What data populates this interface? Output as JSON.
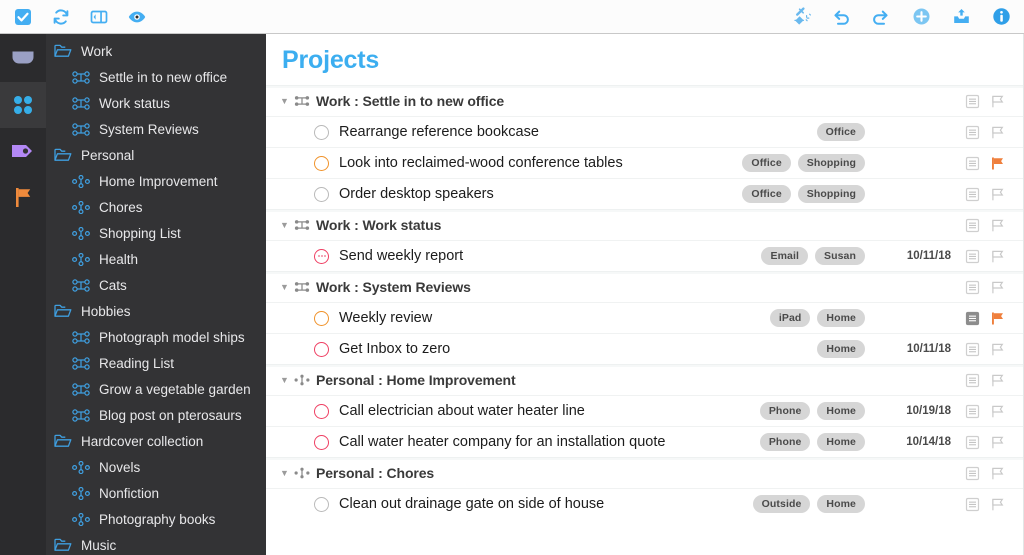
{
  "toolbar": {
    "left": [
      {
        "name": "checkmark-icon",
        "label": "Mark Complete"
      },
      {
        "name": "sync-icon",
        "label": "Sync"
      },
      {
        "name": "sidebar-toggle-icon",
        "label": "Toggle Sidebar"
      },
      {
        "name": "view-icon",
        "label": "View"
      }
    ],
    "right": [
      {
        "name": "cleanup-icon",
        "label": "Clean Up"
      },
      {
        "name": "undo-icon",
        "label": "Undo"
      },
      {
        "name": "redo-icon",
        "label": "Redo"
      },
      {
        "name": "add-icon",
        "label": "Add"
      },
      {
        "name": "inbox-icon",
        "label": "Inbox"
      },
      {
        "name": "info-icon",
        "label": "Inspector"
      }
    ]
  },
  "rail": [
    {
      "name": "rail-inbox",
      "icon": "inbox-tray-icon",
      "color": "#9aa0c4",
      "selected": false
    },
    {
      "name": "rail-projects",
      "icon": "projects-dots-icon",
      "color": "#36aee8",
      "selected": true
    },
    {
      "name": "rail-tags",
      "icon": "tag-icon",
      "color": "#b388f5",
      "selected": false
    },
    {
      "name": "rail-forecast",
      "icon": "flag-icon",
      "color": "#ef8a3c",
      "selected": false
    }
  ],
  "sidebar": {
    "items": [
      {
        "label": "Work",
        "type": "folder",
        "level": 0
      },
      {
        "label": "Settle in to new office",
        "type": "sequential",
        "level": 1
      },
      {
        "label": "Work status",
        "type": "sequential",
        "level": 1
      },
      {
        "label": "System Reviews",
        "type": "sequential",
        "level": 1
      },
      {
        "label": "Personal",
        "type": "folder",
        "level": 0
      },
      {
        "label": "Home Improvement",
        "type": "parallel",
        "level": 1
      },
      {
        "label": "Chores",
        "type": "parallel",
        "level": 1
      },
      {
        "label": "Shopping List",
        "type": "parallel",
        "level": 1
      },
      {
        "label": "Health",
        "type": "parallel",
        "level": 1
      },
      {
        "label": "Cats",
        "type": "sequential",
        "level": 1
      },
      {
        "label": "Hobbies",
        "type": "folder",
        "level": 0
      },
      {
        "label": "Photograph model ships",
        "type": "sequential",
        "level": 1
      },
      {
        "label": "Reading List",
        "type": "sequential",
        "level": 1
      },
      {
        "label": "Grow a vegetable garden",
        "type": "sequential",
        "level": 1
      },
      {
        "label": "Blog post on pterosaurs",
        "type": "sequential",
        "level": 1
      },
      {
        "label": "Hardcover collection",
        "type": "folder",
        "level": 0
      },
      {
        "label": "Novels",
        "type": "parallel",
        "level": 1
      },
      {
        "label": "Nonfiction",
        "type": "parallel",
        "level": 1
      },
      {
        "label": "Photography books",
        "type": "parallel",
        "level": 1
      },
      {
        "label": "Music",
        "type": "folder",
        "level": 0
      }
    ]
  },
  "main": {
    "title": "Projects",
    "groups": [
      {
        "title": "Work : Settle in to new office",
        "project_type": "sequential",
        "expanded": true,
        "has_note": true,
        "flagged": false,
        "tasks": [
          {
            "name": "Rearrange reference bookcase",
            "status": "available",
            "tags": [
              "Office"
            ],
            "due": "",
            "has_note": true,
            "note_active": false,
            "flagged": false
          },
          {
            "name": "Look into reclaimed-wood conference tables",
            "status": "next",
            "tags": [
              "Office",
              "Shopping"
            ],
            "due": "",
            "has_note": true,
            "note_active": false,
            "flagged": true
          },
          {
            "name": "Order desktop speakers",
            "status": "available",
            "tags": [
              "Office",
              "Shopping"
            ],
            "due": "",
            "has_note": true,
            "note_active": false,
            "flagged": false
          }
        ]
      },
      {
        "title": "Work : Work status",
        "project_type": "sequential",
        "expanded": true,
        "has_note": true,
        "flagged": false,
        "tasks": [
          {
            "name": "Send weekly report",
            "status": "due-repeating",
            "tags": [
              "Email",
              "Susan"
            ],
            "due": "10/11/18",
            "has_note": true,
            "note_active": false,
            "flagged": false
          }
        ]
      },
      {
        "title": "Work : System Reviews",
        "project_type": "sequential",
        "expanded": true,
        "has_note": true,
        "flagged": false,
        "tasks": [
          {
            "name": "Weekly review",
            "status": "next",
            "tags": [
              "iPad",
              "Home"
            ],
            "due": "",
            "has_note": true,
            "note_active": true,
            "flagged": true
          },
          {
            "name": "Get Inbox to zero",
            "status": "due",
            "tags": [
              "Home"
            ],
            "due": "10/11/18",
            "has_note": true,
            "note_active": false,
            "flagged": false
          }
        ]
      },
      {
        "title": "Personal : Home Improvement",
        "project_type": "parallel",
        "expanded": true,
        "has_note": true,
        "flagged": false,
        "tasks": [
          {
            "name": "Call electrician about water heater line",
            "status": "due",
            "tags": [
              "Phone",
              "Home"
            ],
            "due": "10/19/18",
            "has_note": true,
            "note_active": false,
            "flagged": false
          },
          {
            "name": "Call water heater company for an installation quote",
            "status": "due",
            "tags": [
              "Phone",
              "Home"
            ],
            "due": "10/14/18",
            "has_note": true,
            "note_active": false,
            "flagged": false
          }
        ]
      },
      {
        "title": "Personal : Chores",
        "project_type": "parallel",
        "expanded": true,
        "has_note": true,
        "flagged": false,
        "tasks": [
          {
            "name": "Clean out drainage gate on side of house",
            "status": "available",
            "tags": [
              "Outside",
              "Home"
            ],
            "due": "",
            "has_note": true,
            "note_active": false,
            "flagged": false
          }
        ]
      }
    ]
  },
  "colors": {
    "accent": "#3caef0",
    "next_action": "#f0932b",
    "overdue": "#ef3f63",
    "flag": "#ef7f3c",
    "tag_bg": "#d6d6d6",
    "sidebar_bg": "#333335",
    "rail_bg": "#2b2b2d"
  }
}
